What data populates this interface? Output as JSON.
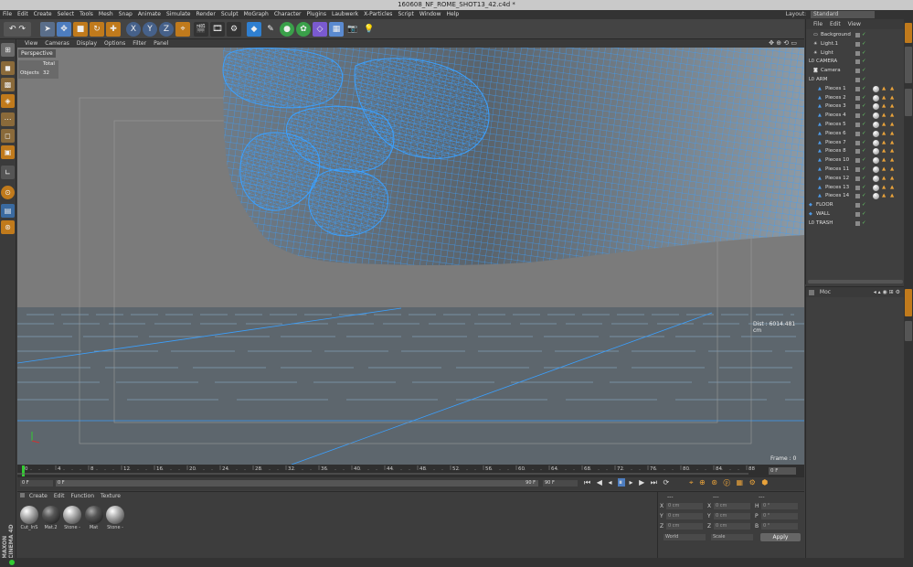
{
  "window": {
    "title": "160608_NF_ROME_SHOT13_42.c4d *"
  },
  "menu": [
    "File",
    "Edit",
    "Create",
    "Select",
    "Tools",
    "Mesh",
    "Snap",
    "Animate",
    "Simulate",
    "Render",
    "Sculpt",
    "MoGraph",
    "Character",
    "Plugins",
    "Laubwerk",
    "X-Particles",
    "Script",
    "Window",
    "Help"
  ],
  "layout": {
    "label": "Layout:",
    "value": "Standard"
  },
  "viewport": {
    "menu": [
      "View",
      "Cameras",
      "Display",
      "Options",
      "Filter",
      "Panel"
    ],
    "projection": "Perspective",
    "stats_header": "Total",
    "stats_label": "Objects",
    "stats_value": "32",
    "dist": "Dist : 6014.481 cm",
    "frame": "Frame : 0"
  },
  "object_manager": {
    "menu": [
      "File",
      "Edit",
      "View"
    ],
    "objects": [
      {
        "name": "Background",
        "indent": 1,
        "icon": "background-icon"
      },
      {
        "name": "Light.1",
        "indent": 1,
        "icon": "light-icon"
      },
      {
        "name": "Light",
        "indent": 1,
        "icon": "light-icon"
      },
      {
        "name": "CAMERA",
        "indent": 0,
        "icon": "null-icon"
      },
      {
        "name": "Camera",
        "indent": 1,
        "icon": "camera-icon"
      },
      {
        "name": "ARM",
        "indent": 0,
        "icon": "null-icon"
      },
      {
        "name": "Pieces 1",
        "indent": 2,
        "icon": "polygon-icon"
      },
      {
        "name": "Pieces 2",
        "indent": 2,
        "icon": "polygon-icon"
      },
      {
        "name": "Pieces 3",
        "indent": 2,
        "icon": "polygon-icon"
      },
      {
        "name": "Pieces 4",
        "indent": 2,
        "icon": "polygon-icon"
      },
      {
        "name": "Pieces 5",
        "indent": 2,
        "icon": "polygon-icon"
      },
      {
        "name": "Pieces 6",
        "indent": 2,
        "icon": "polygon-icon"
      },
      {
        "name": "Pieces 7",
        "indent": 2,
        "icon": "polygon-icon"
      },
      {
        "name": "Pieces 8",
        "indent": 2,
        "icon": "polygon-icon"
      },
      {
        "name": "Pieces 10",
        "indent": 2,
        "icon": "polygon-icon"
      },
      {
        "name": "Pieces 11",
        "indent": 2,
        "icon": "polygon-icon"
      },
      {
        "name": "Pieces 12",
        "indent": 2,
        "icon": "polygon-icon"
      },
      {
        "name": "Pieces 13",
        "indent": 2,
        "icon": "polygon-icon"
      },
      {
        "name": "Pieces 14",
        "indent": 2,
        "icon": "polygon-icon"
      },
      {
        "name": "FLOOR",
        "indent": 0,
        "icon": "floor-icon"
      },
      {
        "name": "WALL",
        "indent": 0,
        "icon": "floor-icon"
      },
      {
        "name": "TRASH",
        "indent": 0,
        "icon": "null-icon"
      }
    ]
  },
  "attributes": {
    "mode": "Moc"
  },
  "timeline": {
    "ticks": [
      "0",
      "4",
      "8",
      "12",
      "16",
      "20",
      "24",
      "28",
      "32",
      "36",
      "40",
      "44",
      "48",
      "52",
      "56",
      "60",
      "64",
      "68",
      "72",
      "76",
      "80",
      "84",
      "88"
    ],
    "end_field": "0 F",
    "current_frame": "0 F",
    "start_field": "0 F",
    "end_frame": "90 F",
    "range_end": "90 F"
  },
  "materials": {
    "menu": [
      "Create",
      "Edit",
      "Function",
      "Texture"
    ],
    "items": [
      {
        "name": "Cut_InS",
        "dark": false
      },
      {
        "name": "Mat.2",
        "dark": true
      },
      {
        "name": "Stone -",
        "dark": false
      },
      {
        "name": "Mat",
        "dark": true
      },
      {
        "name": "Stone -",
        "dark": false
      }
    ]
  },
  "coordinates": {
    "headers": [
      "---",
      "---",
      "---"
    ],
    "rows": [
      {
        "a": "X",
        "av": "0 cm",
        "b": "X",
        "bv": "0 cm",
        "c": "H",
        "cv": "0 °"
      },
      {
        "a": "Y",
        "av": "0 cm",
        "b": "Y",
        "bv": "0 cm",
        "c": "P",
        "cv": "0 °"
      },
      {
        "a": "Z",
        "av": "0 cm",
        "b": "Z",
        "bv": "0 cm",
        "c": "B",
        "cv": "0 °"
      }
    ],
    "world": "World",
    "scale": "Scale",
    "apply": "Apply"
  },
  "branding": {
    "text": "MAXON CINEMA 4D"
  },
  "colors": {
    "wire": "#3aa0ff",
    "viewport_bg": "#7a7a7a",
    "floor": "#5e6a72",
    "accent": "#e8a23a"
  }
}
